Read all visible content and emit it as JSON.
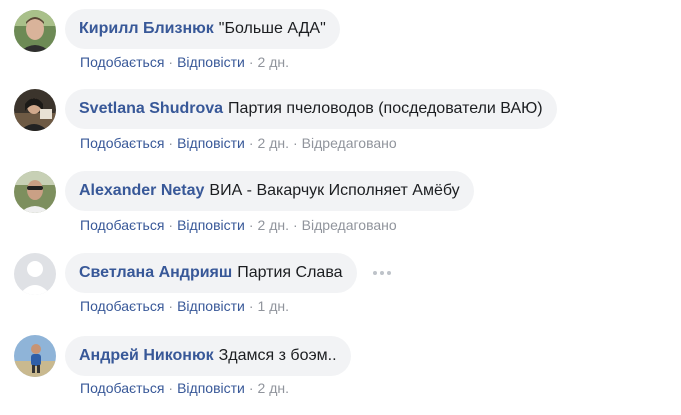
{
  "comments": [
    {
      "author": "Кирилл Близнюк",
      "text": "\"Больше АДА\"",
      "like": "Подобається",
      "reply": "Відповісти",
      "time": "2 дн.",
      "edited": ""
    },
    {
      "author": "Svetlana Shudrova",
      "text": "Партия пчеловодов (посдедователи ВАЮ)",
      "like": "Подобається",
      "reply": "Відповісти",
      "time": "2 дн.",
      "edited": "Відредаговано"
    },
    {
      "author": "Alexander Netay",
      "text": "ВИА - Вакарчук Исполняет Амёбу",
      "like": "Подобається",
      "reply": "Відповісти",
      "time": "2 дн.",
      "edited": "Відредаговано"
    },
    {
      "author": "Светлана Андрияш",
      "text": "Партия Слава",
      "like": "Подобається",
      "reply": "Відповісти",
      "time": "1 дн.",
      "edited": ""
    },
    {
      "author": "Андрей Никонюк",
      "text": "Здамся з боэм..",
      "like": "Подобається",
      "reply": "Відповісти",
      "time": "2 дн.",
      "edited": ""
    }
  ],
  "separator": "·",
  "icons": {
    "avatar": "user-avatar",
    "more": "more-options-icon"
  },
  "colors": {
    "link": "#385898",
    "bubble": "#f2f3f5",
    "meta": "#90949c"
  }
}
